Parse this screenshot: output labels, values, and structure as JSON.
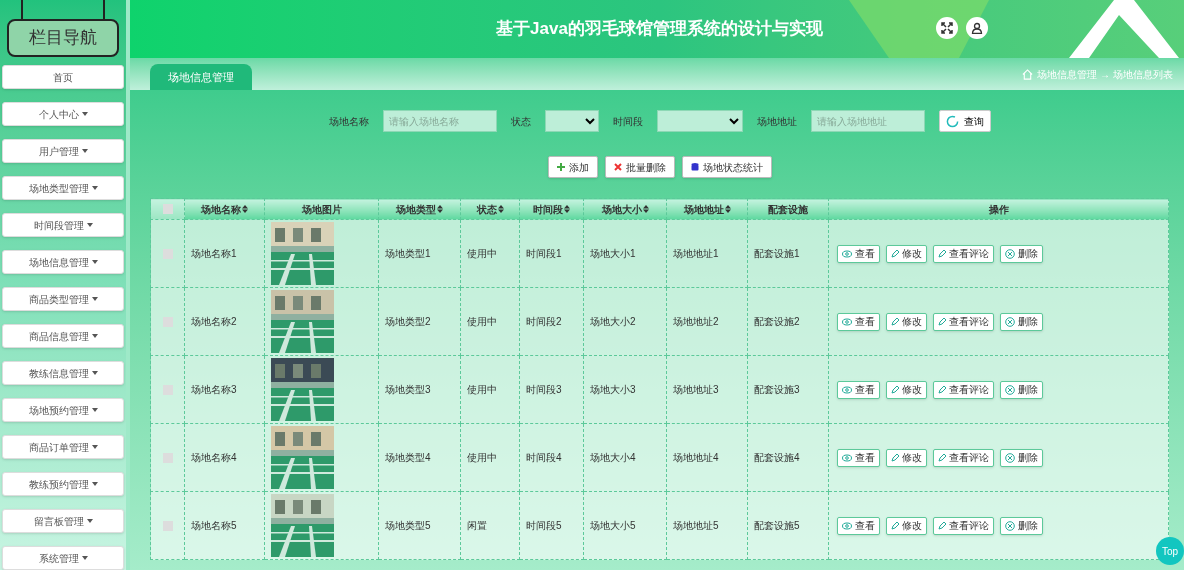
{
  "sidebar": {
    "title": "栏目导航",
    "items": [
      {
        "label": "首页",
        "expandable": false
      },
      {
        "label": "个人中心",
        "expandable": true
      },
      {
        "label": "用户管理",
        "expandable": true
      },
      {
        "label": "场地类型管理",
        "expandable": true
      },
      {
        "label": "时间段管理",
        "expandable": true
      },
      {
        "label": "场地信息管理",
        "expandable": true
      },
      {
        "label": "商品类型管理",
        "expandable": true
      },
      {
        "label": "商品信息管理",
        "expandable": true
      },
      {
        "label": "教练信息管理",
        "expandable": true
      },
      {
        "label": "场地预约管理",
        "expandable": true
      },
      {
        "label": "商品订单管理",
        "expandable": true
      },
      {
        "label": "教练预约管理",
        "expandable": true
      },
      {
        "label": "留言板管理",
        "expandable": true
      },
      {
        "label": "系统管理",
        "expandable": true
      }
    ]
  },
  "header": {
    "title": "基于Java的羽毛球馆管理系统的设计与实现"
  },
  "tab": {
    "label": "场地信息管理",
    "selected": true
  },
  "breadcrumb": [
    "场地信息管理",
    "→",
    "场地信息列表"
  ],
  "search": {
    "fields": [
      {
        "label": "场地名称",
        "kind": "text",
        "placeholder": "请输入场地名称"
      },
      {
        "label": "状态",
        "kind": "select"
      },
      {
        "label": "时间段",
        "kind": "select"
      },
      {
        "label": "场地地址",
        "kind": "text",
        "placeholder": "请输入场地地址"
      }
    ],
    "button": "查询"
  },
  "toolbar": [
    {
      "label": "添加",
      "kind": "add"
    },
    {
      "label": "批量删除",
      "kind": "delete"
    },
    {
      "label": "场地状态统计",
      "kind": "stats"
    }
  ],
  "table": {
    "columns": [
      {
        "label": "场地名称",
        "sortable": true
      },
      {
        "label": "场地图片",
        "sortable": false
      },
      {
        "label": "场地类型",
        "sortable": true
      },
      {
        "label": "状态",
        "sortable": true
      },
      {
        "label": "时间段",
        "sortable": true
      },
      {
        "label": "场地大小",
        "sortable": true
      },
      {
        "label": "场地地址",
        "sortable": true
      },
      {
        "label": "配套设施",
        "sortable": false
      },
      {
        "label": "操作",
        "sortable": false
      }
    ],
    "all_checked": false,
    "rows": [
      {
        "checked": false,
        "cells": [
          "场地名称1",
          {
            "kind": "picture"
          },
          "场地类型1",
          "使用中",
          "时间段1",
          "场地大小1",
          "场地地址1",
          "配套设施1"
        ],
        "actions": [
          {
            "label": "查看",
            "kind": "view"
          },
          {
            "label": "修改",
            "kind": "edit"
          },
          {
            "label": "查看评论",
            "kind": "edit"
          },
          {
            "label": "删除",
            "kind": "delete"
          }
        ]
      },
      {
        "checked": false,
        "cells": [
          "场地名称2",
          {
            "kind": "picture"
          },
          "场地类型2",
          "使用中",
          "时间段2",
          "场地大小2",
          "场地地址2",
          "配套设施2"
        ],
        "actions": [
          {
            "label": "查看",
            "kind": "view"
          },
          {
            "label": "修改",
            "kind": "edit"
          },
          {
            "label": "查看评论",
            "kind": "edit"
          },
          {
            "label": "删除",
            "kind": "delete"
          }
        ]
      },
      {
        "checked": false,
        "cells": [
          "场地名称3",
          {
            "kind": "picture"
          },
          "场地类型3",
          "使用中",
          "时间段3",
          "场地大小3",
          "场地地址3",
          "配套设施3"
        ],
        "actions": [
          {
            "label": "查看",
            "kind": "view"
          },
          {
            "label": "修改",
            "kind": "edit"
          },
          {
            "label": "查看评论",
            "kind": "edit"
          },
          {
            "label": "删除",
            "kind": "delete"
          }
        ]
      },
      {
        "checked": false,
        "cells": [
          "场地名称4",
          {
            "kind": "picture"
          },
          "场地类型4",
          "使用中",
          "时间段4",
          "场地大小4",
          "场地地址4",
          "配套设施4"
        ],
        "actions": [
          {
            "label": "查看",
            "kind": "view"
          },
          {
            "label": "修改",
            "kind": "edit"
          },
          {
            "label": "查看评论",
            "kind": "edit"
          },
          {
            "label": "删除",
            "kind": "delete"
          }
        ]
      },
      {
        "checked": false,
        "cells": [
          "场地名称5",
          {
            "kind": "picture"
          },
          "场地类型5",
          "闲置",
          "时间段5",
          "场地大小5",
          "场地地址5",
          "配套设施5"
        ],
        "actions": [
          {
            "label": "查看",
            "kind": "view"
          },
          {
            "label": "修改",
            "kind": "edit"
          },
          {
            "label": "查看评论",
            "kind": "edit"
          },
          {
            "label": "删除",
            "kind": "delete"
          }
        ]
      }
    ]
  },
  "top_button": "Top"
}
